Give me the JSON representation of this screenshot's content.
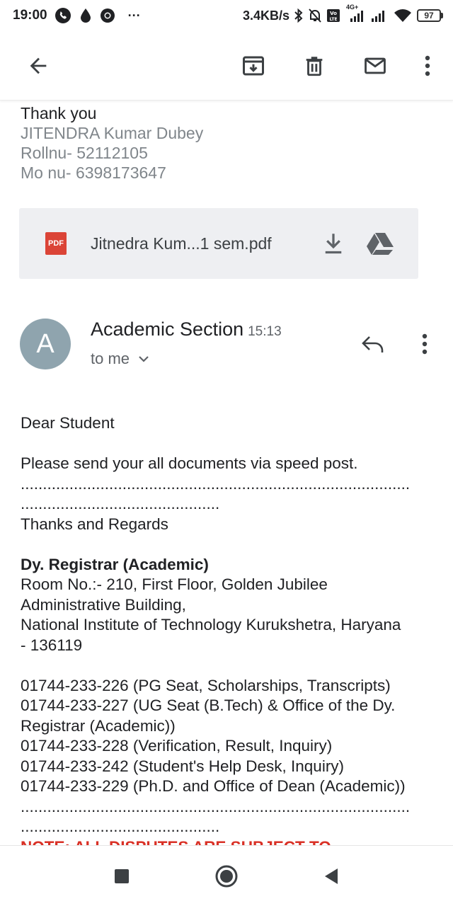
{
  "status_bar": {
    "time": "19:00",
    "left_icons": [
      "phone-icon",
      "water-drop-icon",
      "chrome-icon",
      "more-notifications-icon"
    ],
    "more": "···",
    "net_speed": "3.4KB/s",
    "right_icons": [
      "bluetooth-icon",
      "silent-bell-icon",
      "volte-icon",
      "signal-4g-icon",
      "signal-icon",
      "wifi-icon"
    ],
    "network_type": "4G+",
    "battery": "97"
  },
  "toolbar": {
    "icons": [
      "back-arrow-icon",
      "archive-icon",
      "delete-icon",
      "mark-unread-icon",
      "more-vert-icon"
    ]
  },
  "signature": {
    "thanks": "Thank you",
    "name": "JITENDRA Kumar Dubey",
    "roll": "Rollnu- 52112105",
    "mobile": "Mo nu- 6398173647"
  },
  "attachment": {
    "badge": "PDF",
    "filename": "Jitnedra Kum...1 sem.pdf",
    "icons": [
      "download-icon",
      "drive-icon"
    ]
  },
  "message": {
    "avatar_letter": "A",
    "avatar_color": "#8fa4ae",
    "sender": "Academic Section",
    "time": "15:13",
    "recipient": "to me",
    "icons": [
      "reply-icon",
      "more-vert-icon",
      "chevron-down-icon"
    ]
  },
  "body": {
    "greeting": "Dear Student",
    "request": "Please send your all documents via speed post.",
    "dots_long": "........................................................................................",
    "dots_short": ".............................................",
    "closing": "Thanks and Regards",
    "title": "Dy. Registrar (Academic)",
    "address_1": "Room No.:- 210, First Floor, Golden Jubilee",
    "address_2": "Administrative Building,",
    "address_3": "National Institute of Technology Kurukshetra, Haryana",
    "address_4": "- 136119",
    "phone_1": "01744-233-226 (PG Seat, Scholarships, Transcripts)",
    "phone_2a": "01744-233-227 (UG Seat (B.Tech) & Office of the Dy.",
    "phone_2b": "Registrar (Academic))",
    "phone_3": "01744-233-228 (Verification, Result, Inquiry)",
    "phone_4": "01744-233-242 (Student's Help Desk, Inquiry)",
    "phone_5": "01744-233-229 (Ph.D. and Office of Dean (Academic))",
    "note": "NOTE: ALL DISPUTES ARE SUBJECT TO"
  },
  "nav_bar": {
    "icons": [
      "recents-square-icon",
      "home-circle-icon",
      "back-triangle-icon"
    ]
  },
  "colors": {
    "accent_red": "#db4437",
    "note_red": "#d93025",
    "secondary_text": "#5f6368",
    "muted_text": "#80868b",
    "attachment_bg": "#eeeff2"
  }
}
